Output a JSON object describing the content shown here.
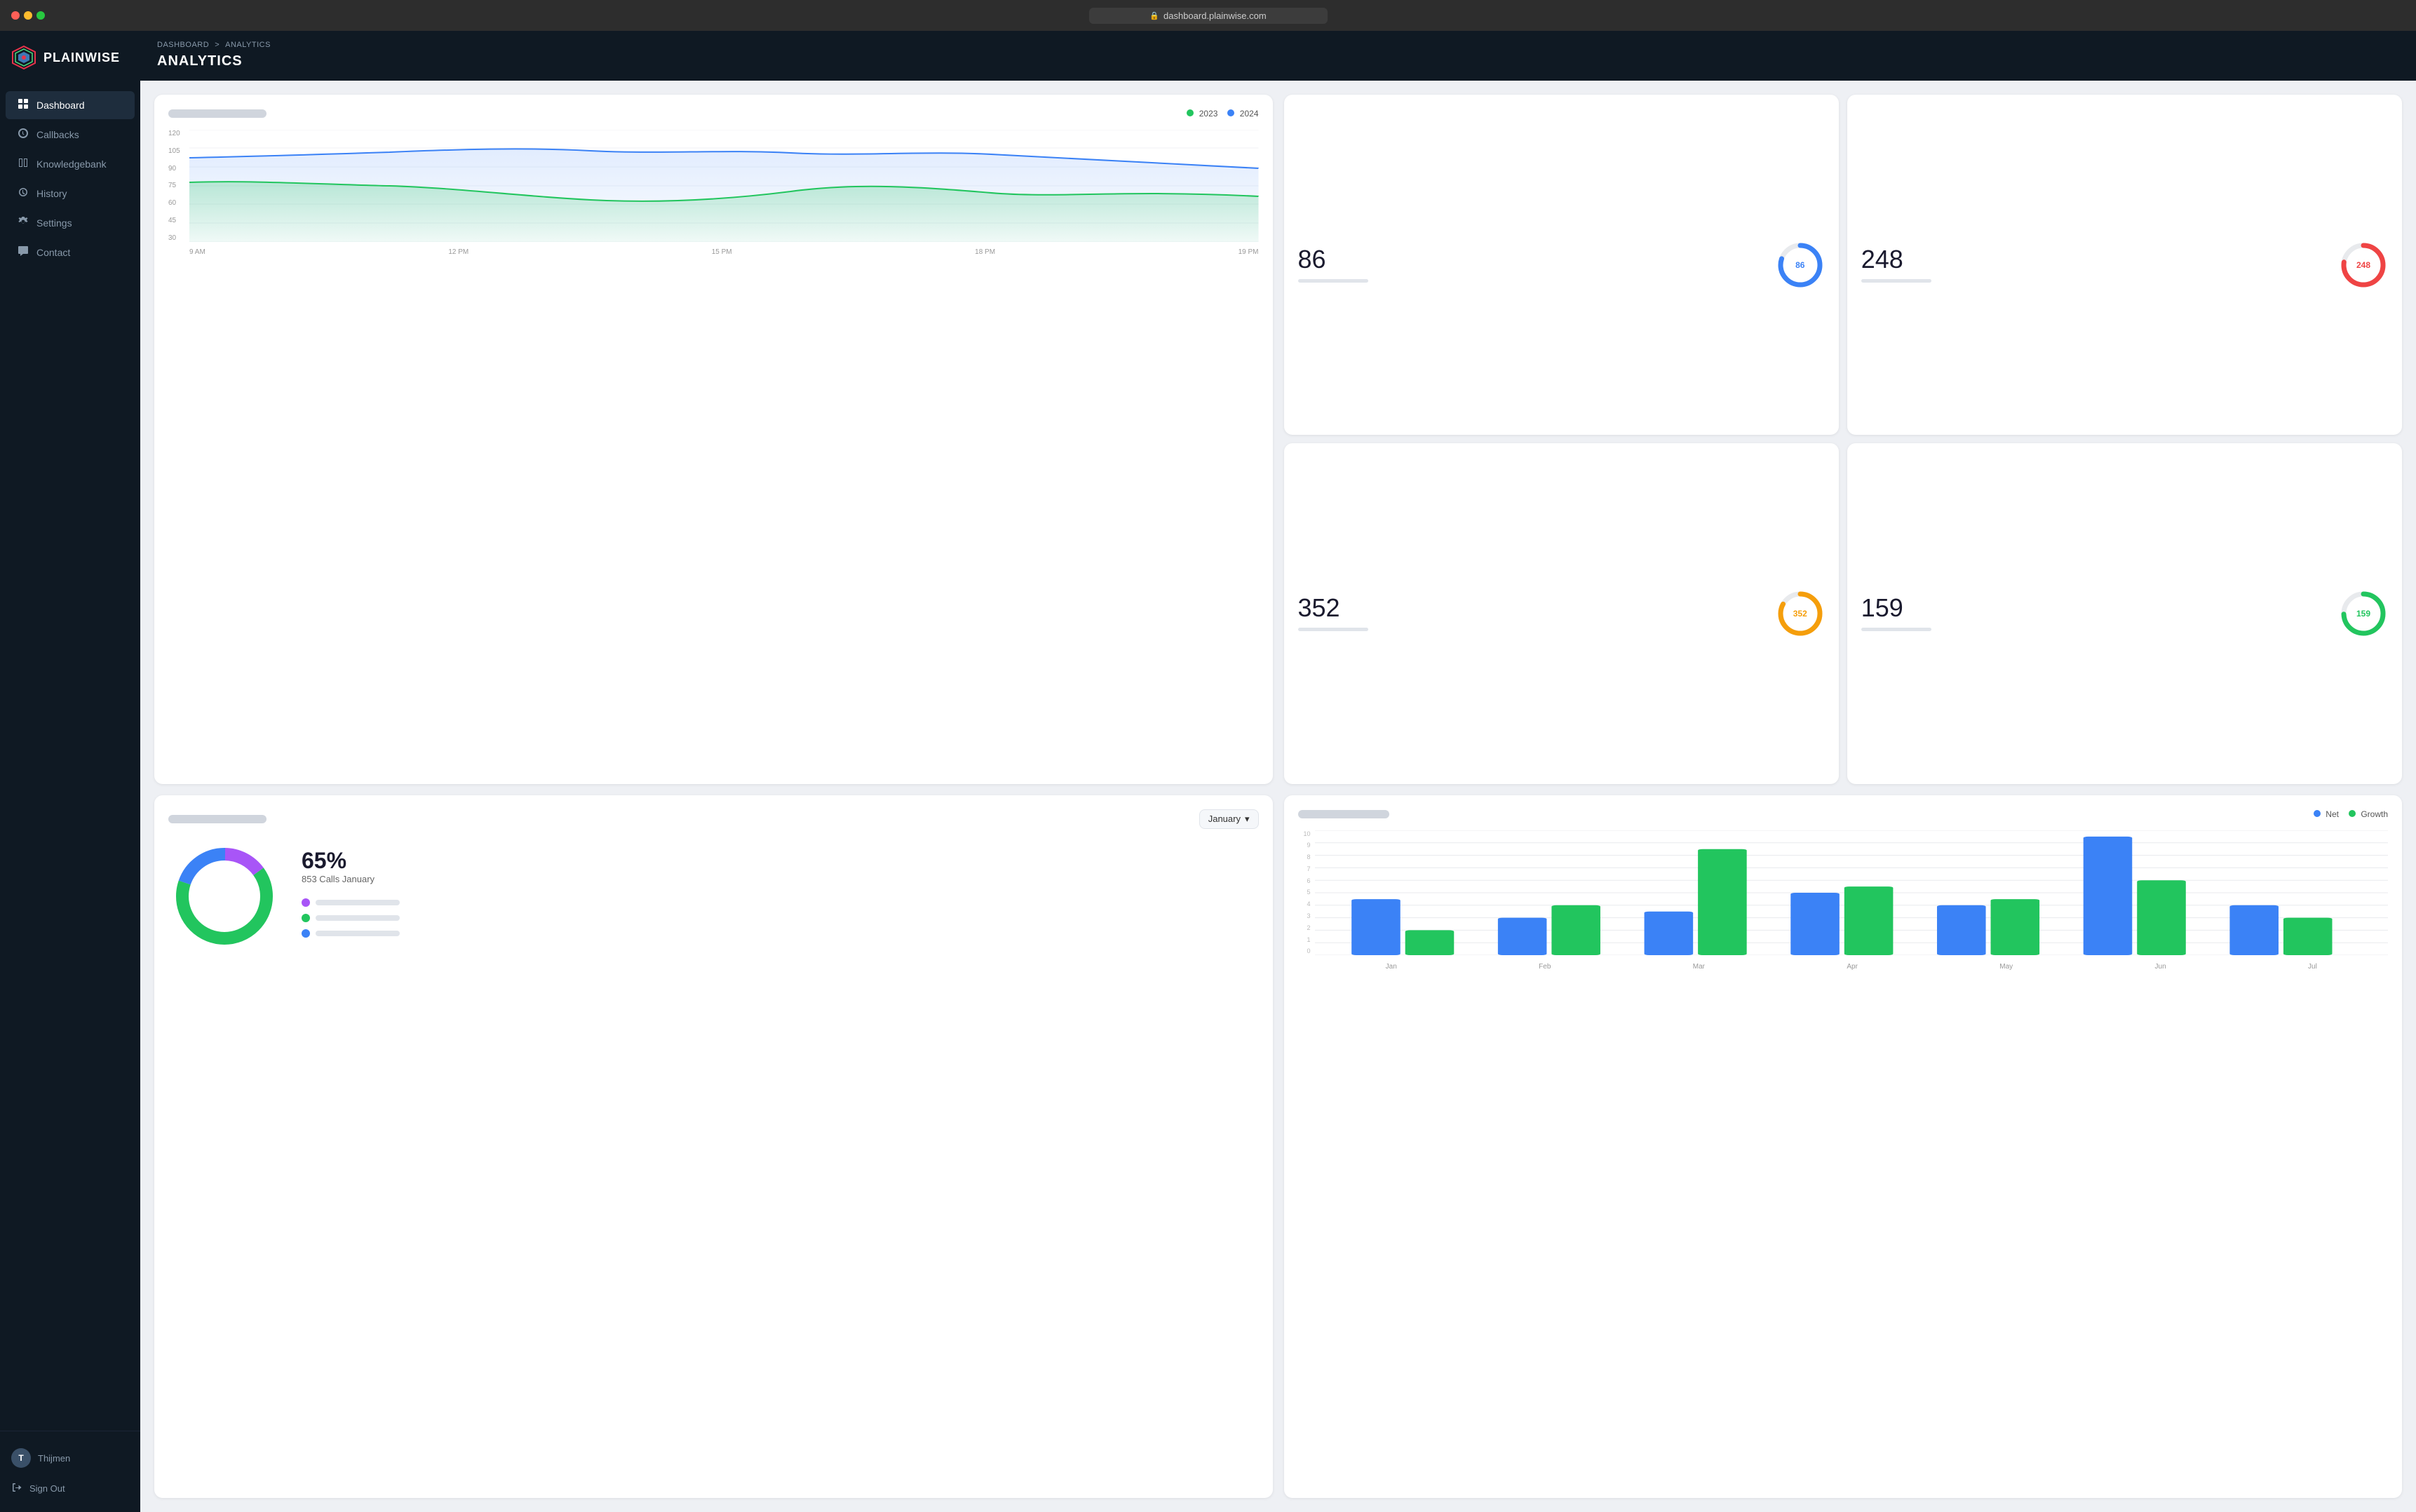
{
  "browser": {
    "url": "dashboard.plainwise.com"
  },
  "sidebar": {
    "logo_text": "PLAINWISE",
    "nav_items": [
      {
        "id": "dashboard",
        "label": "Dashboard",
        "icon": "📊",
        "active": true
      },
      {
        "id": "callbacks",
        "label": "Callbacks",
        "icon": "🔔",
        "active": false
      },
      {
        "id": "knowledgebank",
        "label": "Knowledgebank",
        "icon": "🗄",
        "active": false
      },
      {
        "id": "history",
        "label": "History",
        "icon": "🕐",
        "active": false
      },
      {
        "id": "settings",
        "label": "Settings",
        "icon": "⚙",
        "active": false
      },
      {
        "id": "contact",
        "label": "Contact",
        "icon": "💬",
        "active": false
      }
    ],
    "user": {
      "name": "Thijmen",
      "initials": "T"
    },
    "sign_out": "Sign Out"
  },
  "header": {
    "breadcrumb_home": "DASHBOARD",
    "breadcrumb_sep": ">",
    "breadcrumb_current": "ANALYTICS",
    "page_title": "ANALYTICS"
  },
  "stats": [
    {
      "value": "86",
      "color": "#3b82f6",
      "donut_color": "#3b82f6"
    },
    {
      "value": "248",
      "color": "#ef4444",
      "donut_color": "#ef4444"
    },
    {
      "value": "352",
      "color": "#f59e0b",
      "donut_color": "#f59e0b"
    },
    {
      "value": "159",
      "color": "#22c55e",
      "donut_color": "#22c55e"
    }
  ],
  "line_chart": {
    "legend_2023": "2023",
    "legend_2024": "2024",
    "y_labels": [
      "120",
      "105",
      "90",
      "75",
      "60",
      "45",
      "30"
    ],
    "x_labels": [
      "9 AM",
      "12 PM",
      "15 PM",
      "18 PM",
      "19 PM"
    ]
  },
  "pie_chart": {
    "percentage": "65%",
    "subtitle": "853 Calls January",
    "month_selector": "January",
    "legend_colors": [
      "#a855f7",
      "#22c55e",
      "#3b82f6"
    ]
  },
  "bar_chart": {
    "legend_net": "Net",
    "legend_growth": "Growth",
    "y_labels": [
      "10",
      "9",
      "8",
      "7",
      "6",
      "5",
      "4",
      "3",
      "2",
      "1",
      "0"
    ],
    "x_labels": [
      "Jan",
      "Feb",
      "Mar",
      "Apr",
      "May",
      "Jun",
      "Jul"
    ],
    "net_color": "#3b82f6",
    "growth_color": "#22c55e"
  }
}
